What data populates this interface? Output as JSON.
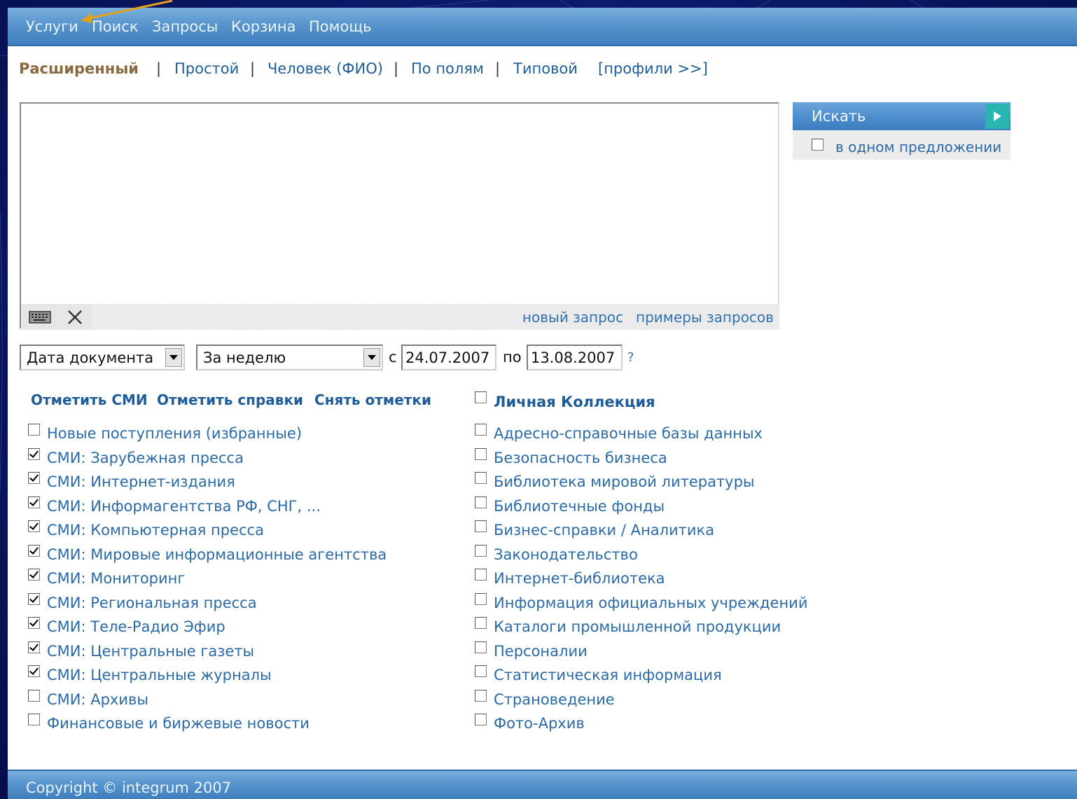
{
  "menu": {
    "items": [
      "Услуги",
      "Поиск",
      "Запросы",
      "Корзина",
      "Помощь"
    ]
  },
  "modes": {
    "active": "Расширенный",
    "links": [
      "Простой",
      "Человек (ФИО)",
      "По полям",
      "Типовой"
    ],
    "separator": "|",
    "profiles": "[профили >>]"
  },
  "query": {
    "value": "",
    "new_query": "новый запрос",
    "examples": "примеры запросов"
  },
  "search": {
    "button_label": "Искать",
    "sentence_label": "в одном предложении",
    "sentence_checked": false
  },
  "date_filter": {
    "field_select": "Дата документа",
    "period_select": "За неделю",
    "from_label": "с",
    "from_value": "24.07.2007",
    "to_label": "по",
    "to_value": "13.08.2007",
    "help": "?"
  },
  "actions": {
    "mark_media": "Отметить СМИ",
    "mark_refs": "Отметить справки",
    "unmark": "Снять отметки"
  },
  "personal_collection": {
    "label": "Личная Коллекция",
    "checked": false
  },
  "left_list": [
    {
      "label": "Новые поступления (избранные)",
      "checked": false
    },
    {
      "label": "СМИ: Зарубежная пресса",
      "checked": true
    },
    {
      "label": "СМИ: Интернет-издания",
      "checked": true
    },
    {
      "label": "СМИ: Информагентства РФ, СНГ, ...",
      "checked": true
    },
    {
      "label": "СМИ: Компьютерная пресса",
      "checked": true
    },
    {
      "label": "СМИ: Мировые информационные агентства",
      "checked": true
    },
    {
      "label": "СМИ: Мониторинг",
      "checked": true
    },
    {
      "label": "СМИ: Региональная пресса",
      "checked": true
    },
    {
      "label": "СМИ: Теле-Радио Эфир",
      "checked": true
    },
    {
      "label": "СМИ: Центральные газеты",
      "checked": true
    },
    {
      "label": "СМИ: Центральные журналы",
      "checked": true
    },
    {
      "label": "СМИ: Архивы",
      "checked": false
    },
    {
      "label": "Финансовые и биржевые новости",
      "checked": false
    }
  ],
  "right_list": [
    {
      "label": "Адресно-справочные базы данных",
      "checked": false
    },
    {
      "label": "Безопасность бизнеса",
      "checked": false
    },
    {
      "label": "Библиотека мировой литературы",
      "checked": false
    },
    {
      "label": "Библиотечные фонды",
      "checked": false
    },
    {
      "label": "Бизнес-справки / Аналитика",
      "checked": false
    },
    {
      "label": "Законодательство",
      "checked": false
    },
    {
      "label": "Интернет-библиотека",
      "checked": false
    },
    {
      "label": "Информация официальных учреждений",
      "checked": false
    },
    {
      "label": "Каталоги промышленной продукции",
      "checked": false
    },
    {
      "label": "Персоналии",
      "checked": false
    },
    {
      "label": "Статистическая информация",
      "checked": false
    },
    {
      "label": "Страноведение",
      "checked": false
    },
    {
      "label": "Фото-Архив",
      "checked": false
    }
  ],
  "footer": {
    "copyright": "Copyright © integrum 2007"
  },
  "colors": {
    "link": "#1f5d9a",
    "active_mode": "#8a6a3e",
    "bar": "#4b8bcb",
    "background": "#0a1a6b"
  }
}
